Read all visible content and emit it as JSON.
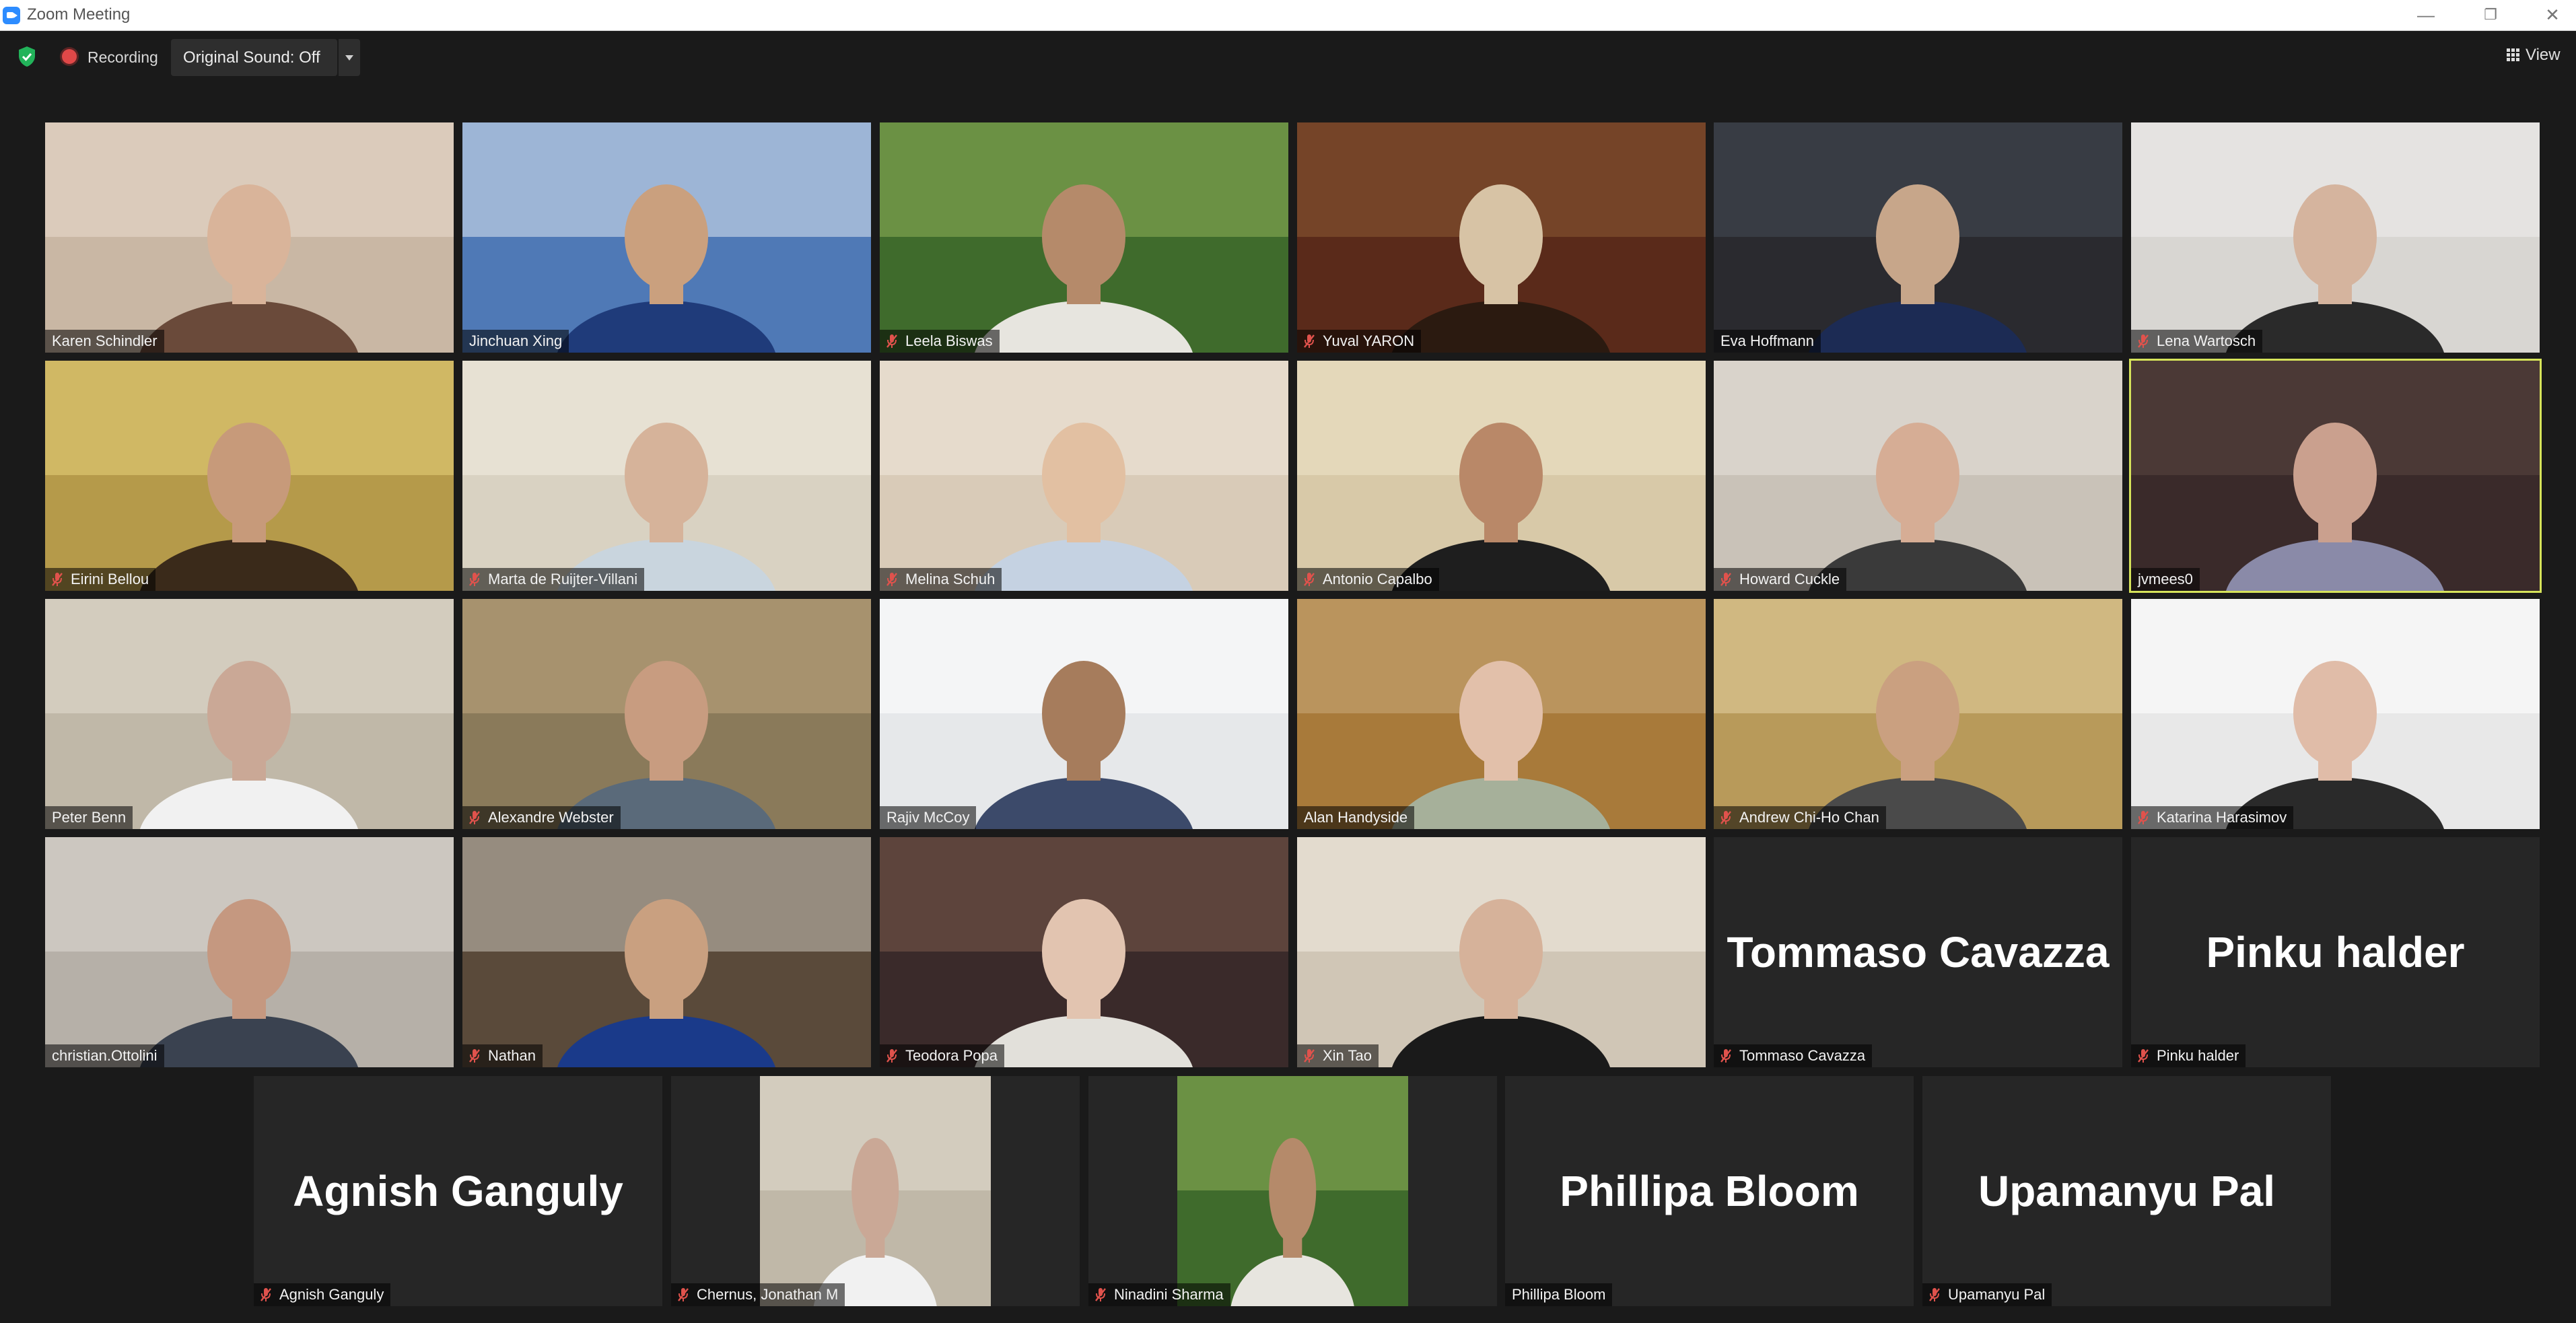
{
  "window": {
    "title": "Zoom Meeting",
    "controls": {
      "minimize": "—",
      "restore": "❐",
      "close": "✕"
    }
  },
  "toolbar": {
    "recording_label": "Recording",
    "original_sound_label": "Original Sound: Off",
    "view_label": "View"
  },
  "colors": {
    "active_speaker_border": "#d6e35a",
    "muted_icon": "#e0524c",
    "recording": "#e04848",
    "security_shield": "#22b35a"
  },
  "participants": [
    {
      "name": "Karen Schindler",
      "muted": false
    },
    {
      "name": "Jinchuan Xing",
      "muted": false
    },
    {
      "name": "Leela Biswas",
      "muted": true
    },
    {
      "name": "Yuval YARON",
      "muted": true
    },
    {
      "name": "Eva Hoffmann",
      "muted": false
    },
    {
      "name": "Lena Wartosch",
      "muted": true
    },
    {
      "name": "Eirini Bellou",
      "muted": true
    },
    {
      "name": "Marta de Ruijter-Villani",
      "muted": true
    },
    {
      "name": "Melina Schuh",
      "muted": true
    },
    {
      "name": "Antonio Capalbo",
      "muted": true
    },
    {
      "name": "Howard Cuckle",
      "muted": true
    },
    {
      "name": "jvmees0",
      "muted": false,
      "active": true
    },
    {
      "name": "Peter Benn",
      "muted": false
    },
    {
      "name": "Alexandre Webster",
      "muted": true
    },
    {
      "name": "Rajiv McCoy",
      "muted": false
    },
    {
      "name": "Alan Handyside",
      "muted": false
    },
    {
      "name": "Andrew Chi-Ho Chan",
      "muted": true
    },
    {
      "name": "Katarina Harasimov",
      "muted": true
    },
    {
      "name": "christian.Ottolini",
      "muted": false
    },
    {
      "name": "Nathan",
      "muted": true
    },
    {
      "name": "Teodora Popa",
      "muted": true
    },
    {
      "name": "Xin Tao",
      "muted": true
    },
    {
      "name": "Tommaso Cavazza",
      "muted": true,
      "video_off": true,
      "big_name": "Tommaso Cavazza"
    },
    {
      "name": "Pinku halder",
      "muted": true,
      "video_off": true,
      "big_name": "Pinku halder"
    },
    {
      "name": "Agnish Ganguly",
      "muted": true,
      "video_off": true,
      "big_name": "Agnish Ganguly"
    },
    {
      "name": "Chernus, Jonathan M",
      "muted": true
    },
    {
      "name": "Ninadini Sharma",
      "muted": true
    },
    {
      "name": "Phillipa Bloom",
      "muted": false,
      "video_off": true,
      "big_name": "Phillipa Bloom"
    },
    {
      "name": "Upamanyu Pal",
      "muted": true,
      "video_off": true,
      "big_name": "Upamanyu Pal"
    }
  ]
}
